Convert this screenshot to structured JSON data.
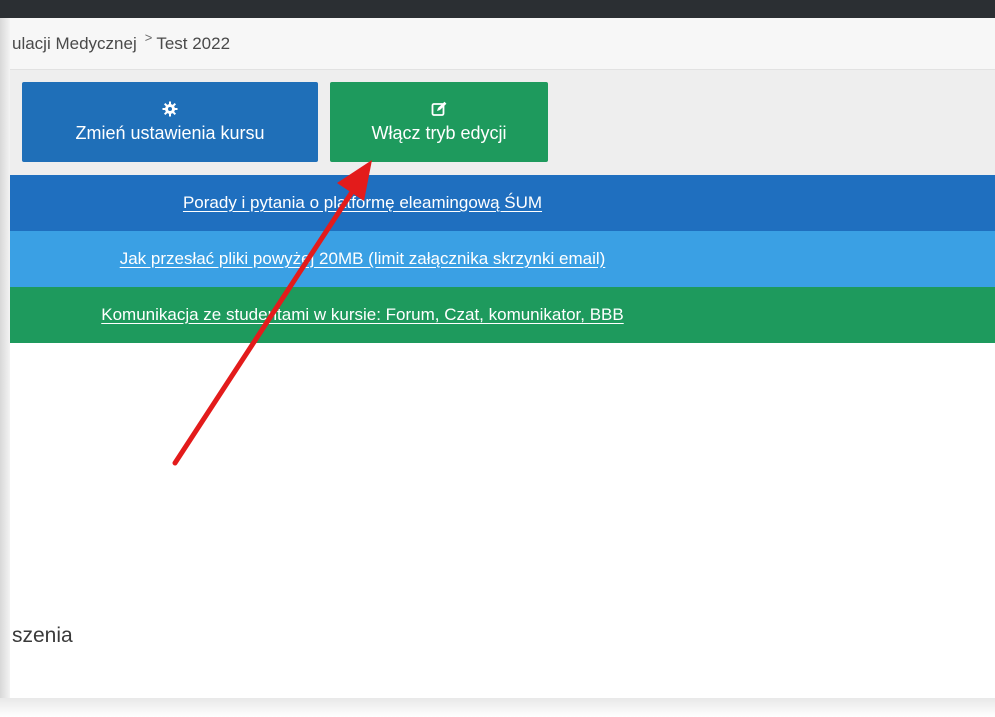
{
  "breadcrumb": {
    "parent": "ulacji Medycznej",
    "separator": ">",
    "current": "Test 2022"
  },
  "toolbar": {
    "course_settings_label": "Zmień ustawienia kursu",
    "edit_mode_label": "Włącz tryb edycji"
  },
  "banners": [
    {
      "label": "Porady i pytania o platformę eleamingową ŚUM"
    },
    {
      "label": "Jak przesłać pliki powyżej 20MB (limit załącznika skrzynki email)"
    },
    {
      "label": "Komunikacja ze studentami w kursie: Forum, Czat, komunikator, BBB"
    }
  ],
  "content": {
    "fragment_text": "szenia"
  },
  "colors": {
    "settings_button": "#1f6fb8",
    "edit_button": "#1e9a5d",
    "banner_1": "#1f6fbf",
    "banner_2": "#3aa0e4",
    "banner_3": "#1e9a5d",
    "annotation_arrow": "#e31b1b"
  },
  "icons": {
    "settings": "gear-icon",
    "edit": "edit-icon"
  }
}
